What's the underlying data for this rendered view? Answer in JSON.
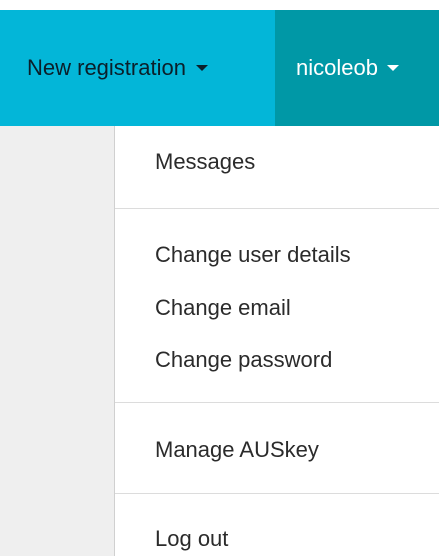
{
  "colors": {
    "registration_bg": "#03b6d8",
    "user_bg": "#0098a6"
  },
  "navbar": {
    "registration_label": "New registration",
    "user_label": "nicoleob"
  },
  "dropdown": {
    "items": [
      "Messages",
      "Change user details",
      "Change email",
      "Change password",
      "Manage AUSkey",
      "Log out"
    ]
  }
}
